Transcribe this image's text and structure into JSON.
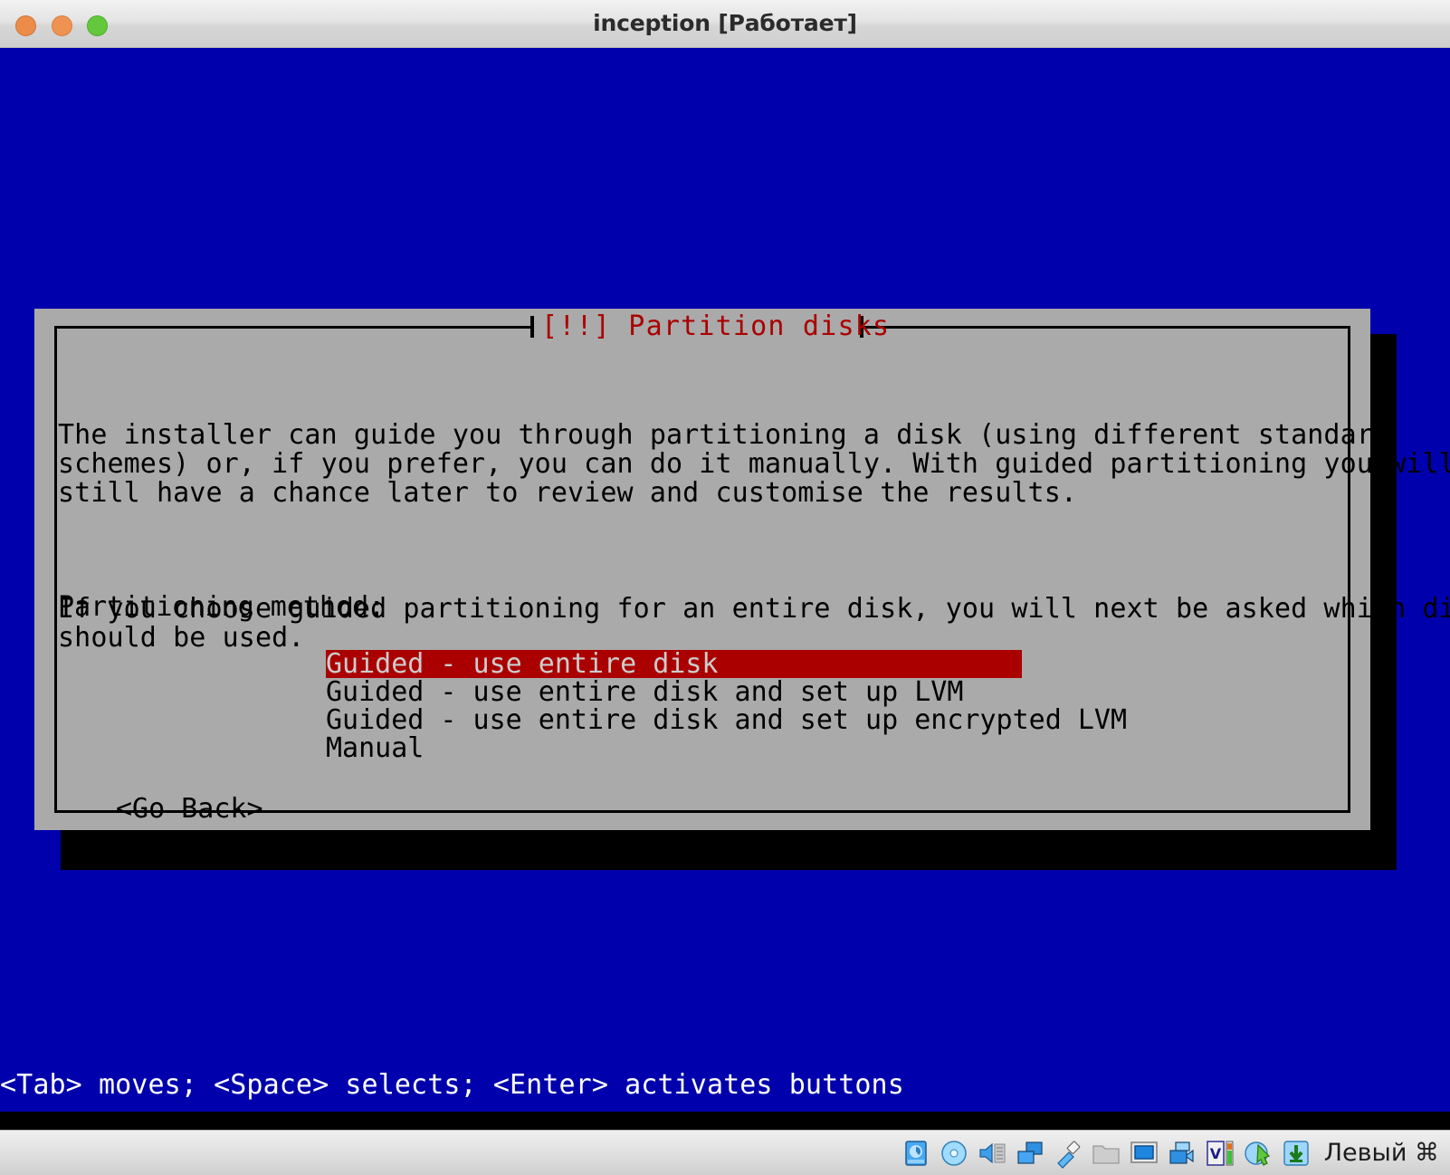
{
  "window": {
    "title": "inception [Работает]",
    "controls": {
      "close": "close-button",
      "minimize": "minimize-button",
      "maximize": "maximize-button"
    }
  },
  "dialog": {
    "title": "[!!] Partition disks",
    "paragraphs": [
      "The installer can guide you through partitioning a disk (using different standard\nschemes) or, if you prefer, you can do it manually. With guided partitioning you will\nstill have a chance later to review and customise the results.",
      "If you choose guided partitioning for an entire disk, you will next be asked which disk\nshould be used."
    ],
    "method_label": "Partitioning method:",
    "options": [
      {
        "label": "Guided - use entire disk",
        "selected": true
      },
      {
        "label": "Guided - use entire disk and set up LVM",
        "selected": false
      },
      {
        "label": "Guided - use entire disk and set up encrypted LVM",
        "selected": false
      },
      {
        "label": "Manual",
        "selected": false
      }
    ],
    "go_back": "<Go Back>",
    "colors": {
      "panel": "#aaaaaa",
      "title": "#aa0000",
      "highlight_bg": "#aa0000",
      "highlight_fg": "#cccccc",
      "screen_bg": "#0000ac"
    }
  },
  "status_line": "<Tab> moves; <Space> selects; <Enter> activates buttons",
  "vbox_statusbar": {
    "icons": [
      "hard-disk-icon",
      "optical-disk-icon",
      "audio-icon",
      "network-icon",
      "usb-icon",
      "shared-folders-icon",
      "display-icon",
      "video-capture-icon",
      "cpu-indicator-icon",
      "mouse-integration-icon",
      "host-key-indicator-icon"
    ],
    "host_key": "Левый ⌘"
  }
}
